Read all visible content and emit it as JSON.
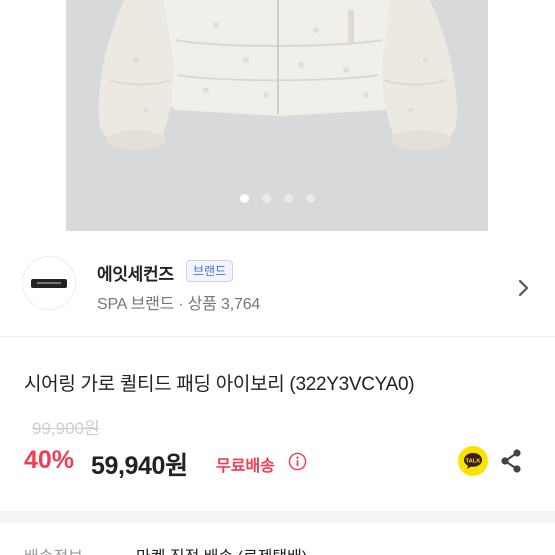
{
  "carousel": {
    "dots": 4,
    "active_index": 0
  },
  "brand": {
    "name": "에잇세컨즈",
    "badge": "브랜드",
    "meta": "SPA 브랜드 · 상품 3,764"
  },
  "product": {
    "title": "시어링 가로 퀼티드 패딩  아이보리 (322Y3VCYA0)",
    "original_price": "99,900원",
    "discount_rate": "40%",
    "sale_price": "59,940원",
    "free_shipping": "무료배송"
  },
  "actions": {
    "kakao_label": "TALK"
  },
  "shipping": {
    "label": "배송정보",
    "value": "마켓 직접 배송 (로젠택배)"
  },
  "colors": {
    "accent_red": "#ee3e55",
    "badge_blue": "#4a6fd1",
    "kakao_yellow": "#fbe300"
  }
}
